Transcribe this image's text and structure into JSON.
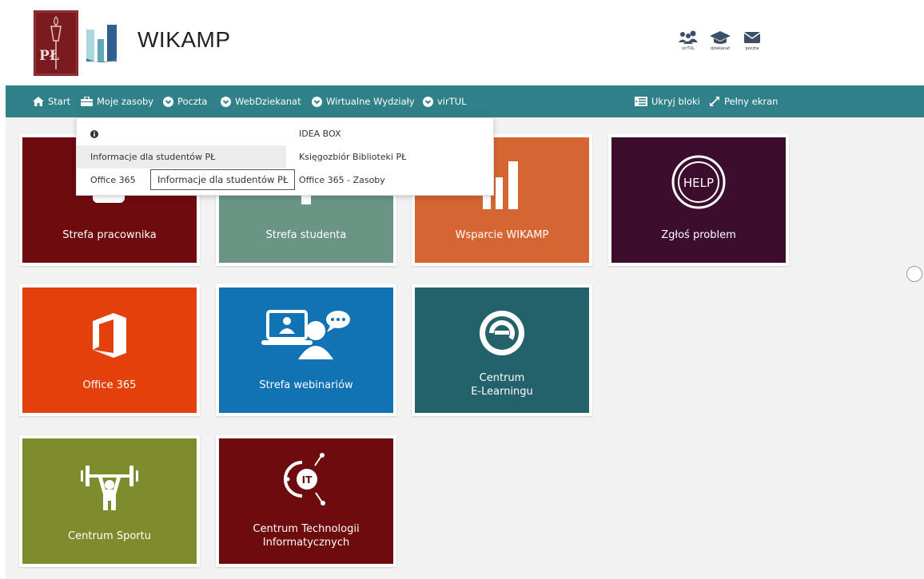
{
  "header": {
    "logo_text": "PŁ",
    "site_title": "WIKAMP",
    "top_icons": [
      {
        "icon": "users-icon",
        "label": "virTUL"
      },
      {
        "icon": "graduation-cap-icon",
        "label": "dziekanat"
      },
      {
        "icon": "mail-icon",
        "label": "poczta"
      }
    ]
  },
  "nav": {
    "start": "Start",
    "moje_zasoby": "Moje zasoby",
    "poczta": "Poczta",
    "webdziekanat": "WebDziekanat",
    "wirtualne": "Wirtualne Wydziały",
    "virtul": "virTUL",
    "ukryj": "Ukryj bloki",
    "pelny": "Pełny ekran"
  },
  "dropdown": {
    "left": [
      "",
      "Informacje dla studentów PŁ",
      "Office 365"
    ],
    "right": [
      "IDEA BOX",
      "Księgozbiór Biblioteki PŁ",
      "Office 365 - Zasoby"
    ],
    "tooltip": "Informacje dla studentów PŁ"
  },
  "tiles": [
    {
      "label": "Strefa pracownika",
      "color": "#6d0b0f"
    },
    {
      "label": "Strefa studenta",
      "color": "#6a9585"
    },
    {
      "label": "Wsparcie WIKAMP",
      "color": "#d56532"
    },
    {
      "label": "Zgłoś problem",
      "color": "#3d0d2e",
      "icon_text": "HELP"
    },
    {
      "label": "Office 365",
      "color": "#e3400b"
    },
    {
      "label": "Strefa webinariów",
      "color": "#1273b4"
    },
    {
      "label": "Centrum\nE-Learningu",
      "color": "#23626b"
    },
    {
      "label": "Centrum Sportu",
      "color": "#7f8c2e"
    },
    {
      "label": "Centrum Technologii\nInformatycznych",
      "color": "#6d0b0f",
      "icon_text": "IT"
    }
  ]
}
